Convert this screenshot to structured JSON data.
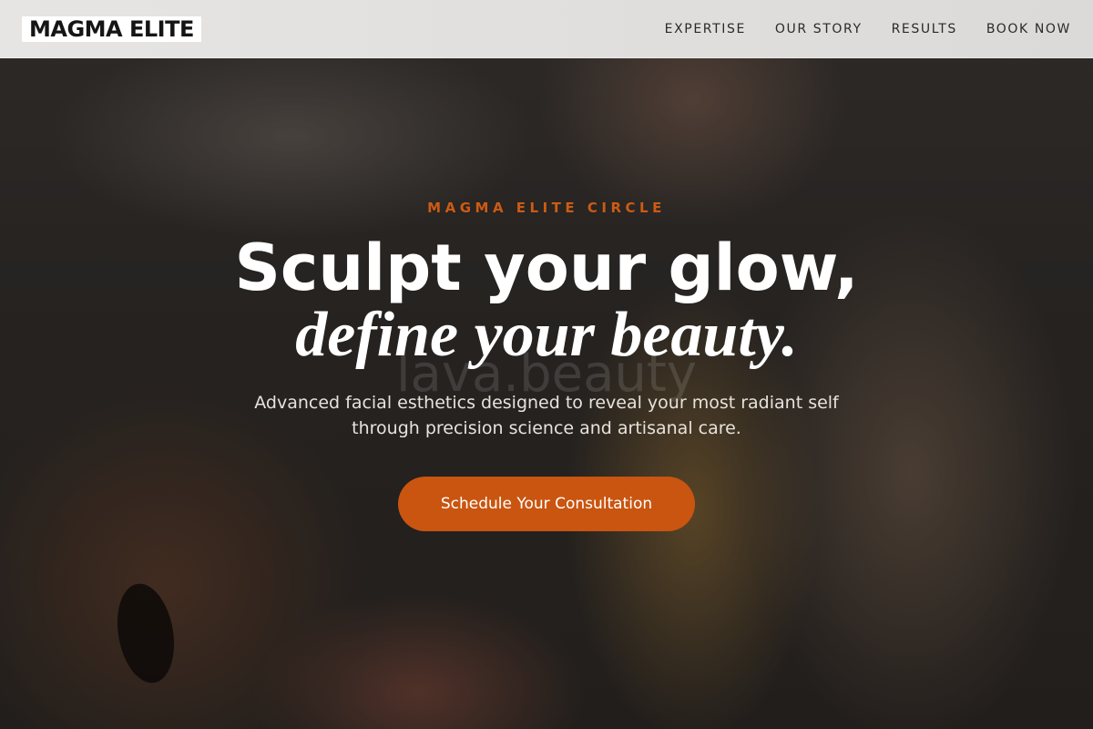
{
  "brand": {
    "logo": "MAGMA ELITE"
  },
  "nav": {
    "items": [
      "EXPERTISE",
      "OUR STORY",
      "RESULTS",
      "BOOK NOW"
    ]
  },
  "hero": {
    "watermark": "lava.beauty",
    "eyebrow": "MAGMA ELITE CIRCLE",
    "headline_line1": "Sculpt your glow,",
    "headline_line2": "define your beauty.",
    "description": "Advanced facial esthetics designed to reveal your most radiant self through precision science and artisanal care.",
    "cta_label": "Schedule Your Consultation"
  },
  "colors": {
    "accent": "#cc5b14",
    "cta_background": "#c95510",
    "header_background": "#e6e5e3"
  }
}
